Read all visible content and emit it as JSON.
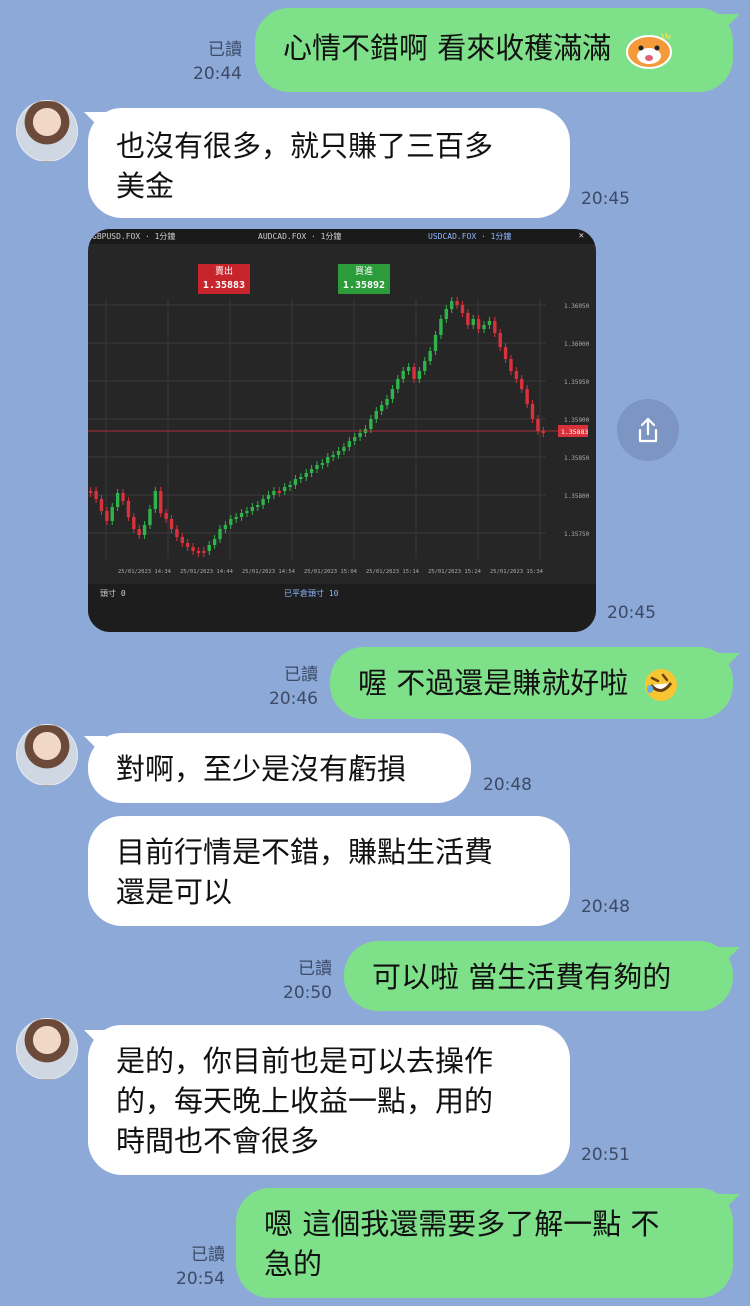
{
  "colors": {
    "background": "#8da9d8",
    "outgoing": "#7fe08a",
    "incoming": "#ffffff"
  },
  "messages": [
    {
      "dir": "out",
      "text": "心情不錯啊 看來收穫滿滿",
      "read": "已讀",
      "time": "20:44",
      "attachment": "cat-sticker-icon"
    },
    {
      "dir": "in",
      "lines": [
        "也沒有很多，就只賺了三百多",
        "美金"
      ],
      "time": "20:45"
    },
    {
      "dir": "in",
      "type": "image",
      "time": "20:45"
    },
    {
      "dir": "out",
      "text": "喔 不過還是賺就好啦",
      "read": "已讀",
      "time": "20:46",
      "attachment": "rofl-emoji-icon"
    },
    {
      "dir": "in",
      "text": "對啊，至少是沒有虧損",
      "time": "20:48"
    },
    {
      "dir": "in",
      "lines": [
        "目前行情是不錯，賺點生活費",
        "還是可以"
      ],
      "time": "20:48"
    },
    {
      "dir": "out",
      "text": "可以啦 當生活費有夠的",
      "read": "已讀",
      "time": "20:50"
    },
    {
      "dir": "in",
      "lines": [
        "是的，你目前也是可以去操作",
        "的，每天晚上收益一點，用的",
        "時間也不會很多"
      ],
      "time": "20:51"
    },
    {
      "dir": "out",
      "lines": [
        "嗯 這個我還需要多了解一點 不",
        "急的"
      ],
      "read": "已讀",
      "time": "20:54"
    }
  ],
  "chart_image": {
    "tabs": [
      "GBPUSD.FOX · 1分鐘",
      "AUDCAD.FOX · 1分鐘",
      "USDCAD.FOX · 1分鐘"
    ],
    "sell_label": "賣出",
    "sell_price": "1.35883",
    "buy_label": "買進",
    "buy_price": "1.35892",
    "current_price": "1.35883",
    "price_ticks": [
      "1.36050",
      "1.36000",
      "1.35950",
      "1.35900",
      "1.35850",
      "1.35800",
      "1.35750"
    ],
    "time_ticks": [
      "25/01/2023 14:34",
      "25/01/2023 14:44",
      "25/01/2023 14:54",
      "25/01/2023 15:04",
      "25/01/2023 15:14",
      "25/01/2023 15:24",
      "25/01/2023 15:34"
    ],
    "footer_left": "頭寸 0",
    "footer_mid": "已平倉頭寸 10"
  }
}
